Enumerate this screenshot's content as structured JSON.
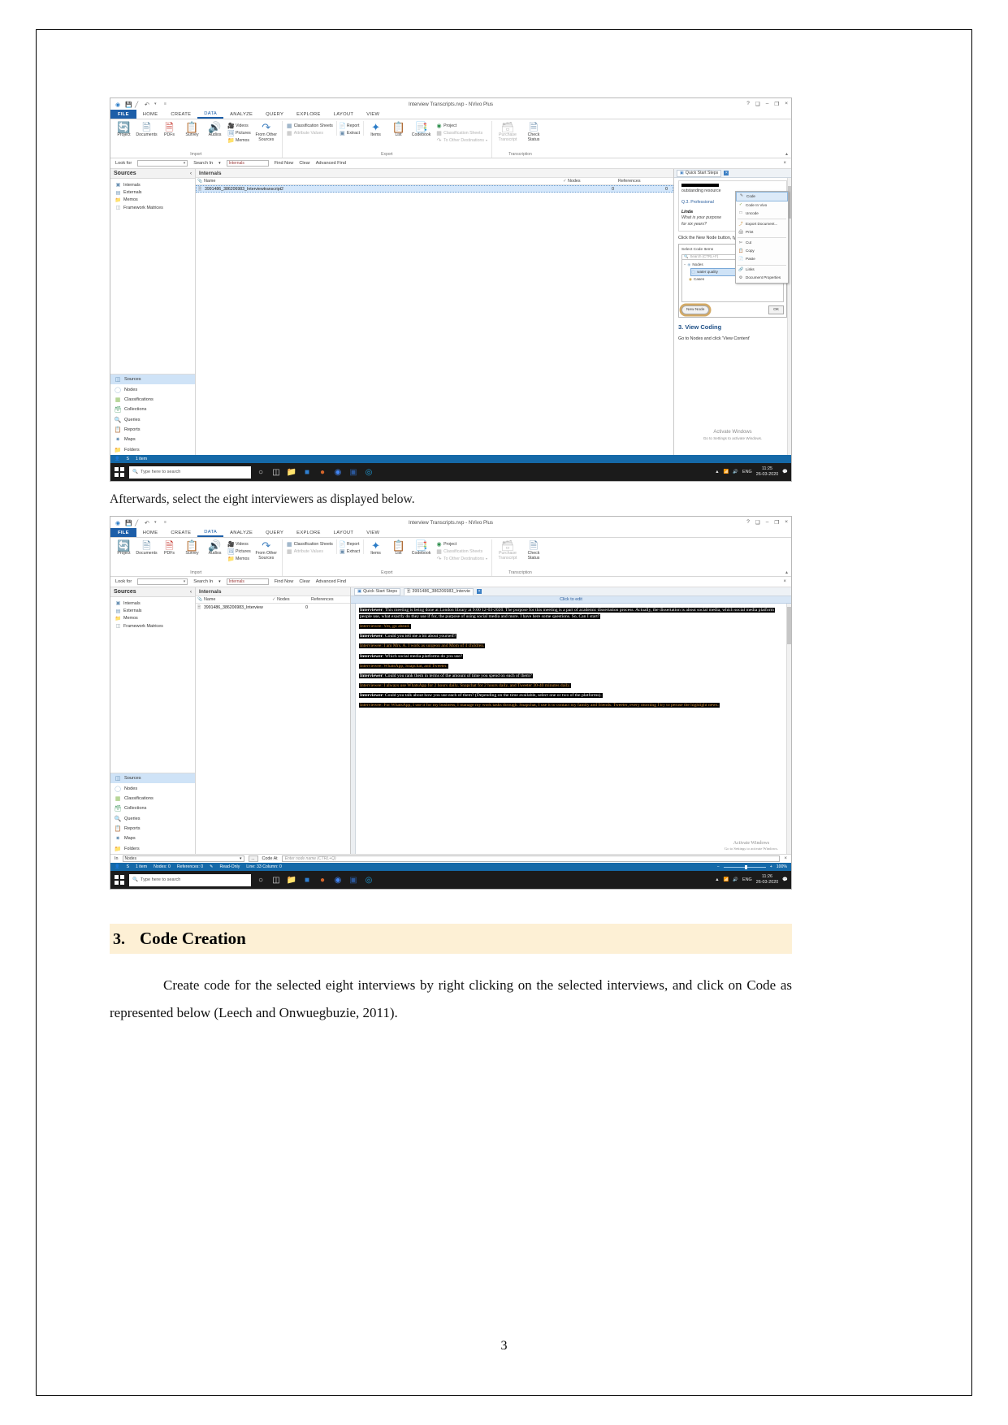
{
  "document": {
    "page_number": "3",
    "caption_after_first": "Afterwards, select the eight interviewers as displayed below.",
    "section": {
      "number": "3.",
      "title": "Code Creation",
      "paragraph": "Create code for the selected eight interviews by right clicking on the selected interviews, and click on Code as represented below (Leech and Onwuegbuzie, 2011)."
    }
  },
  "nvivo": {
    "window_title": "Interview Transcripts.nvp - NVivo Plus",
    "quick_access": {
      "save_icon": "save-icon",
      "edit_icon": "pencil-icon",
      "undo_icon": "undo-icon",
      "more_icon": "chevron-down-icon"
    },
    "window_controls": {
      "help": "?",
      "ribbon_options": "❑",
      "minimize": "–",
      "maximize": "❐",
      "close": "×"
    },
    "ribbon_tabs": [
      "FILE",
      "HOME",
      "CREATE",
      "DATA",
      "ANALYZE",
      "QUERY",
      "EXPLORE",
      "LAYOUT",
      "VIEW"
    ],
    "active_tab": "DATA",
    "ribbon_groups": [
      {
        "label": "Import",
        "big_buttons": [
          {
            "label": "Project",
            "icon": "project-import-icon"
          },
          {
            "label": "Documents",
            "icon": "documents-icon"
          },
          {
            "label": "PDFs",
            "icon": "pdf-icon"
          },
          {
            "label": "Survey",
            "icon": "survey-icon"
          },
          {
            "label": "Audios",
            "icon": "audio-icon"
          }
        ],
        "small_buttons": [
          {
            "label": "Videos",
            "icon": "video-icon",
            "enabled": true
          },
          {
            "label": "Pictures",
            "icon": "picture-icon",
            "enabled": true
          },
          {
            "label": "Memos",
            "icon": "memo-icon",
            "enabled": true
          }
        ],
        "extra_big": [
          {
            "label": "From Other Sources",
            "icon": "from-other-sources-icon"
          }
        ]
      },
      {
        "label": "Export",
        "small_buttons": [
          {
            "label": "Classification Sheets",
            "icon": "classification-sheets-icon",
            "enabled": true
          },
          {
            "label": "Attribute Values",
            "icon": "attribute-values-icon",
            "enabled": false
          },
          {
            "label": "Report",
            "icon": "report-icon",
            "enabled": true
          },
          {
            "label": "Extract",
            "icon": "extract-icon",
            "enabled": true
          },
          {
            "label": "Project",
            "icon": "project-export-icon",
            "enabled": true
          },
          {
            "label": "Classification Sheets",
            "icon": "classification-sheets-icon",
            "enabled": false
          },
          {
            "label": "To Other Destinations",
            "icon": "to-other-destinations-icon",
            "enabled": false
          }
        ],
        "big_buttons": [
          {
            "label": "Items",
            "icon": "items-icon"
          },
          {
            "label": "List",
            "icon": "list-icon"
          },
          {
            "label": "Codebook",
            "icon": "codebook-icon"
          }
        ]
      },
      {
        "label": "Transcription",
        "big_buttons": [
          {
            "label": "Purchase Transcript",
            "icon": "purchase-transcript-icon"
          },
          {
            "label": "Check Status",
            "icon": "check-status-icon"
          }
        ]
      }
    ],
    "find_bar": {
      "look_for_label": "Look for",
      "look_for_value": "",
      "search_in_label": "Search In",
      "search_in_value": "Internals",
      "find_now": "Find Now",
      "clear": "Clear",
      "advanced_find": "Advanced Find",
      "close": "×"
    },
    "sources_panel": {
      "title": "Sources",
      "collapse_icon": "chevron-left-icon",
      "tree": [
        {
          "label": "Internals",
          "icon": "internals-icon",
          "selected": true
        },
        {
          "label": "Externals",
          "icon": "externals-icon",
          "selected": false
        },
        {
          "label": "Memos",
          "icon": "memos-folder-icon",
          "selected": false
        },
        {
          "label": "Framework Matrices",
          "icon": "framework-matrices-icon",
          "selected": false
        }
      ]
    },
    "nav_items": [
      {
        "label": "Sources",
        "icon": "sources-icon",
        "selected": true
      },
      {
        "label": "Nodes",
        "icon": "nodes-icon",
        "selected": false
      },
      {
        "label": "Classifications",
        "icon": "classifications-icon",
        "selected": false
      },
      {
        "label": "Collections",
        "icon": "collections-icon",
        "selected": false
      },
      {
        "label": "Queries",
        "icon": "queries-icon",
        "selected": false
      },
      {
        "label": "Reports",
        "icon": "reports-icon",
        "selected": false
      },
      {
        "label": "Maps",
        "icon": "maps-icon",
        "selected": false
      },
      {
        "label": "Folders",
        "icon": "folders-icon",
        "selected": false
      }
    ],
    "list_view": {
      "title": "Internals",
      "columns": [
        "Name",
        "Nodes",
        "References"
      ],
      "sort_indicator": "✓",
      "rows_shot1": [
        {
          "name": "3991486_386206983_Interviewtranscript2",
          "nodes": "0",
          "references": "0"
        }
      ],
      "rows_shot2": [
        {
          "name": "3991486_386206983_Interview",
          "nodes": "0",
          "references": ""
        }
      ]
    },
    "quick_start": {
      "tab_label": "Quick Start Steps",
      "tab_icon": "quick-start-icon",
      "close_icon": "×",
      "quote_fragment": "outstanding resource",
      "question_label": "Q.3. Professional",
      "speaker": "Linda",
      "speaker_line_1": "What is your purpose",
      "speaker_line_2": "for six years?",
      "instruction": "Click the New Node button, type a",
      "dialog": {
        "title": "Select Code Items",
        "search_placeholder": "Search (CTRL+F)",
        "search_icon": "search-icon",
        "tree": [
          {
            "label": "Nodes",
            "icon": "nodes-icon",
            "selected": false,
            "expander": "−"
          },
          {
            "label": "water quality",
            "icon": "node-circle-icon",
            "selected": true
          },
          {
            "label": "Cases",
            "icon": "cases-icon",
            "selected": false
          }
        ],
        "new_node_button": "New Node",
        "ok_button": "OK"
      },
      "step_heading": "3. View Coding",
      "step_text": "Go to Nodes and click 'View Content'",
      "context_menu": [
        {
          "label": "Code",
          "icon": "code-icon",
          "highlighted": true
        },
        {
          "label": "Code In Vivo",
          "icon": "code-in-vivo-icon",
          "highlighted": false
        },
        {
          "label": "Uncode",
          "icon": "uncode-icon",
          "highlighted": false
        },
        {
          "label": "Export Document...",
          "icon": "export-icon",
          "highlighted": false
        },
        {
          "label": "Print",
          "icon": "print-icon",
          "highlighted": false
        },
        {
          "label": "Cut",
          "icon": "cut-icon",
          "highlighted": false
        },
        {
          "label": "Copy",
          "icon": "copy-icon",
          "highlighted": false
        },
        {
          "label": "Paste",
          "icon": "paste-icon",
          "highlighted": false
        },
        {
          "label": "Links",
          "icon": "links-icon",
          "highlighted": false
        },
        {
          "label": "Document Properties",
          "icon": "properties-icon",
          "highlighted": false
        }
      ]
    },
    "activate_windows": {
      "title": "Activate Windows",
      "subtitle": "Go to Settings to activate Windows."
    },
    "document_view": {
      "tabs": [
        {
          "label": "Quick Start Steps",
          "icon": "quick-start-icon",
          "active": false
        },
        {
          "label": "3991486_386206983_Intervie",
          "icon": "document-icon",
          "active": true
        }
      ],
      "close_icon": "×",
      "click_to_edit": "Click to edit",
      "transcript": [
        {
          "speaker": "Interviewer",
          "text": "This meeting is being done at London library at 9:00 12-03-2020. The purpose for this meeting is a part of academic dissertation process. Actually, the dissertation is about social media, which social media platform people use, what exactly do they use if for, the purpose of using social media and more. I have here some questions. So, Can I start?"
        },
        {
          "speaker": "Interviewee",
          "text": "Yes, go ahead."
        },
        {
          "speaker": "Interviewer",
          "text": "Could you tell me a bit about yourself?"
        },
        {
          "speaker": "Interviewee",
          "text": "I am Mrs. A. I work as surgeon and Mom of 4 children."
        },
        {
          "speaker": "Interviewer",
          "text": "Which social media platforms do you use?"
        },
        {
          "speaker": "Interviewee",
          "text": "WhatsApp, Snapchat, and Tweeter."
        },
        {
          "speaker": "Interviewer",
          "text": "Could you rank them in terms of the amount of time you spend on each of them?"
        },
        {
          "speaker": "Interviewee",
          "text": "I always use WhatsApp for 2 hours daily, Snapchat for 2 hours daily, and Tweeter 30-40 minutes daily."
        },
        {
          "speaker": "Interviewer",
          "text": "Could you talk about how you use each of them? (Depending on the time available, select one or two of the platforms)."
        },
        {
          "speaker": "Interviewee",
          "text": "For WhatsApp, I use it for my business, I manage my work tasks through. Snapchat, I use it to contact my family and friends. Tweeter, every morning I try to peruse the highlight news."
        }
      ]
    },
    "code_bar": {
      "in_label": "In",
      "scope_value": "Nodes",
      "dropdown_icon": "chevron-down-icon",
      "browse_label": "...",
      "code_at_label": "Code At",
      "node_name_placeholder": "Enter node name (CTRL+Q)",
      "close_icon": "×"
    },
    "status_bar_shot1": {
      "user_icon": "user-icon",
      "user": "S",
      "items": "1 item"
    },
    "status_bar_shot2": {
      "user_icon": "user-icon",
      "user": "S",
      "items": "1 item",
      "nodes": "Nodes: 0",
      "references": "References: 0",
      "read_only_icon": "read-only-icon",
      "read_only": "Read-Only",
      "line_column": "Line: 33 Column: 0",
      "zoom_percent": "100%"
    },
    "taskbar": {
      "start_icon": "windows-start-icon",
      "search_icon": "search-icon",
      "search_placeholder": "Type here to search",
      "cortana_icon": "cortana-circle-icon",
      "taskview_icon": "task-view-icon",
      "apps": [
        {
          "icon": "file-explorer-icon",
          "color": "#f5c242"
        },
        {
          "icon": "blue-app-icon",
          "color": "#2f7fd1"
        },
        {
          "icon": "orange-app-icon",
          "color": "#d4652a"
        },
        {
          "icon": "chrome-icon",
          "color": "#4285f4"
        },
        {
          "icon": "word-icon",
          "color": "#2b579a"
        },
        {
          "icon": "media-app-icon",
          "color": "#1d9ad6"
        }
      ],
      "tray": {
        "chevron_icon": "chevron-up-icon",
        "network_icon": "network-icon",
        "sound_icon": "sound-icon",
        "language": "ENG"
      },
      "clock_shot1": {
        "time": "11:25",
        "date": "26-03-2020"
      },
      "clock_shot2": {
        "time": "11:26",
        "date": "26-03-2020"
      },
      "notification_icon": "notification-icon"
    }
  }
}
